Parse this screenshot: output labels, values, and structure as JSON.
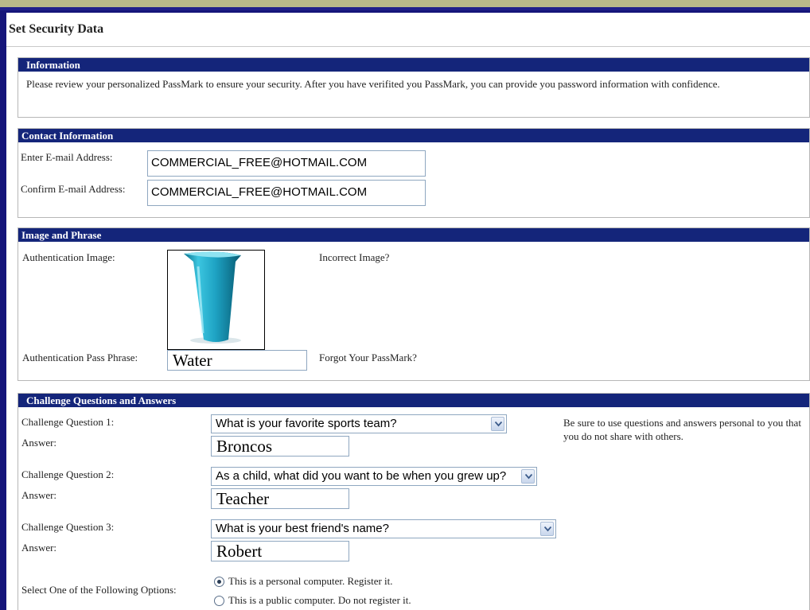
{
  "page": {
    "title": "Set Security Data"
  },
  "information": {
    "header": "Information",
    "text": "Please review your personalized PassMark to ensure your security. After you have verifited you PassMark, you can provide you password information with confidence."
  },
  "contact": {
    "header": "Contact Information",
    "email_label": "Enter E-mail Address:",
    "email_value": "COMMERCIAL_FREE@HOTMAIL.COM",
    "confirm_label": "Confirm E-mail Address:",
    "confirm_value": "COMMERCIAL_FREE@HOTMAIL.COM"
  },
  "image_phrase": {
    "header": "Image and Phrase",
    "image_label": "Authentication Image:",
    "incorrect_link": "Incorrect Image?",
    "phrase_label": "Authentication Pass Phrase:",
    "phrase_value": "Water",
    "forgot_link": "Forgot Your PassMark?"
  },
  "challenge": {
    "header": "Challenge Questions and Answers",
    "note": "Be sure to use questions and answers personal to you that you do not share with others.",
    "answer_label": "Answer:",
    "questions": [
      {
        "label": "Challenge Question 1:",
        "selected": "What is your favorite sports team?",
        "answer": "Broncos"
      },
      {
        "label": "Challenge Question 2:",
        "selected": "As a child, what did you want to be when you grew up?",
        "answer": "Teacher"
      },
      {
        "label": "Challenge Question 3:",
        "selected": "What is your best friend's name?",
        "answer": "Robert"
      }
    ],
    "options_label": "Select One of the Following Options:",
    "options": [
      {
        "label": "This is a personal computer. Register it.",
        "checked": true
      },
      {
        "label": "This is a public computer. Do not register it.",
        "checked": false
      }
    ]
  },
  "colors": {
    "header_bg": "#14257a",
    "frame": "#15157a",
    "input_border": "#8fa7c0"
  },
  "icons": {
    "select_arrow": "chevron-down-icon",
    "auth_image": "cup-image"
  }
}
